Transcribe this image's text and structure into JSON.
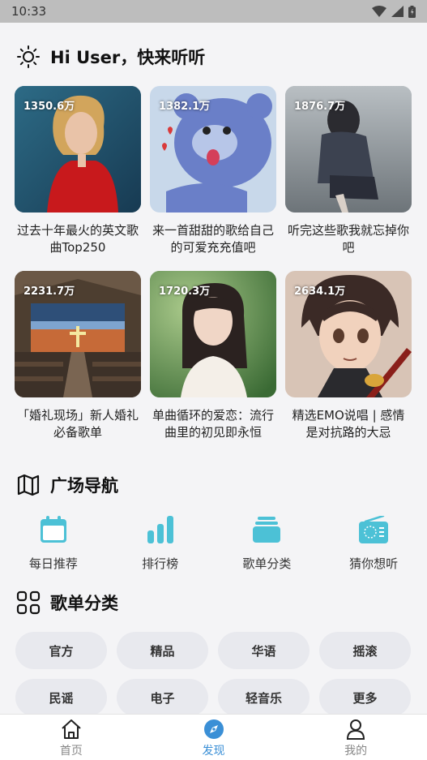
{
  "status_bar": {
    "time": "10:33"
  },
  "header": {
    "greeting": "Hi User，快来听听"
  },
  "playlists": [
    {
      "plays": "1350.6万",
      "title": "过去十年最火的英文歌曲Top250"
    },
    {
      "plays": "1382.1万",
      "title": "来一首甜甜的歌给自己的可爱充充值吧"
    },
    {
      "plays": "1876.7万",
      "title": "听完这些歌我就忘掉你吧"
    },
    {
      "plays": "2231.7万",
      "title": "「婚礼现场」新人婚礼必备歌单"
    },
    {
      "plays": "1720.3万",
      "title": "单曲循环的爱恋：流行曲里的初见即永恒"
    },
    {
      "plays": "2634.1万",
      "title": "精选EMO说唱 | 感情是对抗路的大忌"
    }
  ],
  "plaza": {
    "title": "广场导航",
    "items": [
      {
        "label": "每日推荐",
        "icon": "calendar-icon"
      },
      {
        "label": "排行榜",
        "icon": "bar-chart-icon"
      },
      {
        "label": "歌单分类",
        "icon": "stack-icon"
      },
      {
        "label": "猜你想听",
        "icon": "radio-icon"
      }
    ]
  },
  "categories": {
    "title": "歌单分类",
    "items": [
      "官方",
      "精品",
      "华语",
      "摇滚",
      "民谣",
      "电子",
      "轻音乐",
      "更多"
    ]
  },
  "tabbar": {
    "items": [
      {
        "label": "首页",
        "icon": "home-icon"
      },
      {
        "label": "发现",
        "icon": "compass-icon",
        "active": true
      },
      {
        "label": "我的",
        "icon": "user-icon"
      }
    ]
  },
  "colors": {
    "accent": "#3a8fd6",
    "nav_icon": "#4cc1d6",
    "chip_bg": "#e8e9ee"
  }
}
